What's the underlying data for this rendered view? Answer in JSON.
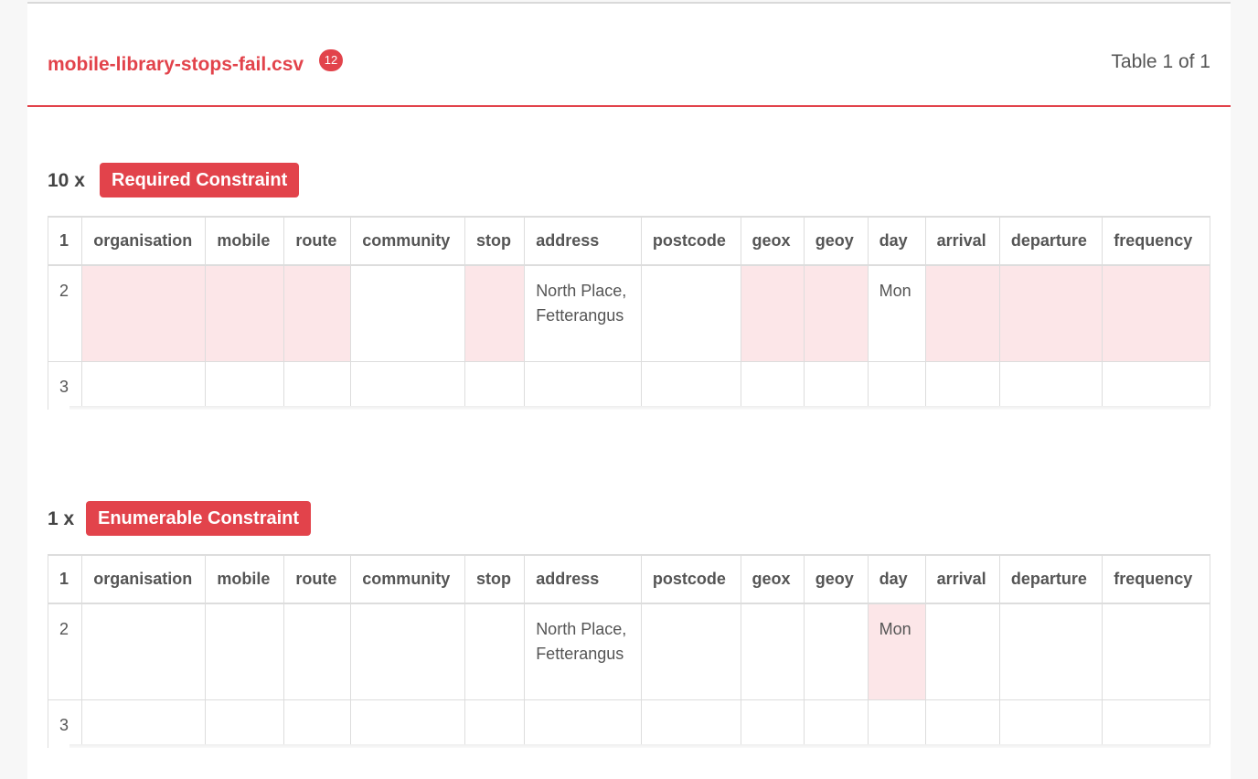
{
  "header": {
    "file_name": "mobile-library-stops-fail.csv",
    "error_count": "12",
    "table_counter": "Table 1 of 1"
  },
  "columns": [
    "organisation",
    "mobile",
    "route",
    "community",
    "stop",
    "address",
    "postcode",
    "geox",
    "geoy",
    "day",
    "arrival",
    "departure",
    "frequency"
  ],
  "errors": [
    {
      "multiplier": "10 x",
      "label": "Required Constraint",
      "header_row_num": "1",
      "rows": [
        {
          "num": "2",
          "cells": [
            "",
            "",
            "",
            "",
            "",
            "North Place, Fetterangus",
            "",
            "",
            "",
            "Mon",
            "",
            "",
            ""
          ],
          "highlight": [
            0,
            1,
            2,
            4,
            7,
            8,
            10,
            11,
            12
          ]
        },
        {
          "num": "3",
          "cells": [
            "",
            "",
            "",
            "",
            "",
            "",
            "",
            "",
            "",
            "",
            "",
            "",
            ""
          ],
          "highlight": []
        }
      ]
    },
    {
      "multiplier": "1 x",
      "label": "Enumerable Constraint",
      "header_row_num": "1",
      "rows": [
        {
          "num": "2",
          "cells": [
            "",
            "",
            "",
            "",
            "",
            "North Place, Fetterangus",
            "",
            "",
            "",
            "Mon",
            "",
            "",
            ""
          ],
          "highlight": [
            9
          ]
        },
        {
          "num": "3",
          "cells": [
            "",
            "",
            "",
            "",
            "",
            "",
            "",
            "",
            "",
            "",
            "",
            "",
            ""
          ],
          "highlight": []
        }
      ]
    }
  ]
}
